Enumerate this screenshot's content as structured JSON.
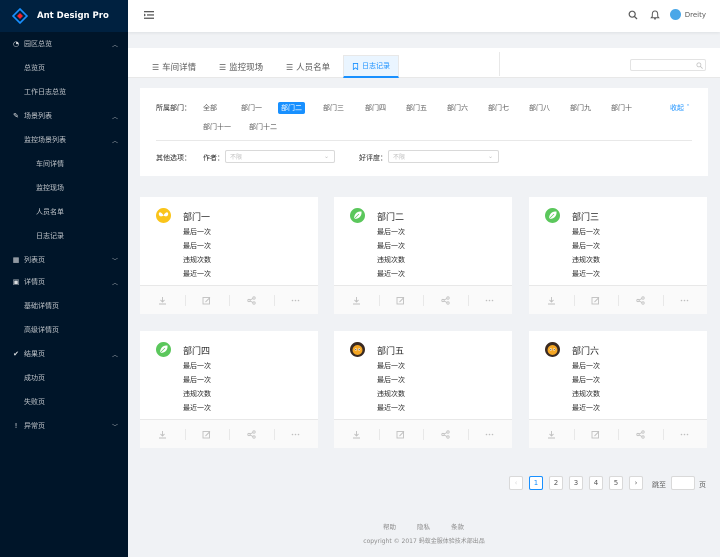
{
  "app": {
    "title": "Ant Design Pro"
  },
  "sidebar": {
    "items": [
      {
        "label": "园区总览",
        "icon": "dashboard-icon",
        "expanded": true
      },
      {
        "label": "总览页"
      },
      {
        "label": "工作日志总览"
      },
      {
        "label": "场景列表",
        "icon": "form-icon",
        "expanded": true
      },
      {
        "label": "监控场景列表",
        "expanded": true
      },
      {
        "label": "车间详情"
      },
      {
        "label": "监控现场"
      },
      {
        "label": "人员名单"
      },
      {
        "label": "日志记录"
      },
      {
        "label": "列表页",
        "icon": "table-icon",
        "expanded": false
      },
      {
        "label": "详情页",
        "icon": "profile-icon",
        "expanded": true
      },
      {
        "label": "基础详情页"
      },
      {
        "label": "高级详情页"
      },
      {
        "label": "结果页",
        "icon": "check-circle-icon",
        "expanded": true
      },
      {
        "label": "成功页"
      },
      {
        "label": "失败页"
      },
      {
        "label": "异常页",
        "icon": "warning-icon",
        "expanded": false
      }
    ]
  },
  "header": {
    "user_name": "Dreity"
  },
  "tabs": [
    {
      "label": "车间详情",
      "icon": "menu-icon"
    },
    {
      "label": "监控现场",
      "icon": "menu-icon"
    },
    {
      "label": "人员名单",
      "icon": "menu-icon"
    },
    {
      "label": "日志记录",
      "icon": "bookmark-icon",
      "active": true
    }
  ],
  "filter": {
    "dept_label": "所属部门：",
    "departments": [
      "全部",
      "部门一",
      "部门二",
      "部门三",
      "部门四",
      "部门五",
      "部门六",
      "部门七",
      "部门八",
      "部门九",
      "部门十",
      "部门十一",
      "部门十二"
    ],
    "selected_department": "部门二",
    "collapse_label": "收起",
    "other_label": "其他选项：",
    "author_label": "作者：",
    "author_placeholder": "不限",
    "rating_label": "好评度：",
    "rating_placeholder": "不限"
  },
  "cards": [
    {
      "title": "部门一",
      "avatar": "butterfly",
      "avatar_color": "#fac41a",
      "lines": [
        "最后一次",
        "最后一次",
        "违规次数",
        "最近一次"
      ]
    },
    {
      "title": "部门二",
      "avatar": "leaf",
      "avatar_color": "#5bc75c",
      "lines": [
        "最后一次",
        "最后一次",
        "违规次数",
        "最近一次"
      ]
    },
    {
      "title": "部门三",
      "avatar": "leaf",
      "avatar_color": "#5bc75c",
      "lines": [
        "最后一次",
        "最后一次",
        "违规次数",
        "最近一次"
      ]
    },
    {
      "title": "部门四",
      "avatar": "leaf",
      "avatar_color": "#5bc75c",
      "lines": [
        "最后一次",
        "最后一次",
        "违规次数",
        "最近一次"
      ]
    },
    {
      "title": "部门五",
      "avatar": "monster",
      "avatar_color": "#3a2a22",
      "lines": [
        "最后一次",
        "最后一次",
        "违规次数",
        "最近一次"
      ]
    },
    {
      "title": "部门六",
      "avatar": "monster",
      "avatar_color": "#3a2a22",
      "lines": [
        "最后一次",
        "最后一次",
        "违规次数",
        "最近一次"
      ]
    }
  ],
  "card_actions": [
    "download-icon",
    "edit-icon",
    "share-icon",
    "ellipsis-icon"
  ],
  "pagination": {
    "pages": [
      "1",
      "2",
      "3",
      "4",
      "5"
    ],
    "current": "1",
    "jump_prefix": "跳至",
    "jump_suffix": "页"
  },
  "footer": {
    "links": [
      "帮助",
      "隐私",
      "条款"
    ],
    "copyright": "copyright © 2017 蚂蚁金服体验技术部出品"
  },
  "colors": {
    "primary": "#1890ff",
    "sider": "#001529",
    "background": "#f0f2f5"
  }
}
